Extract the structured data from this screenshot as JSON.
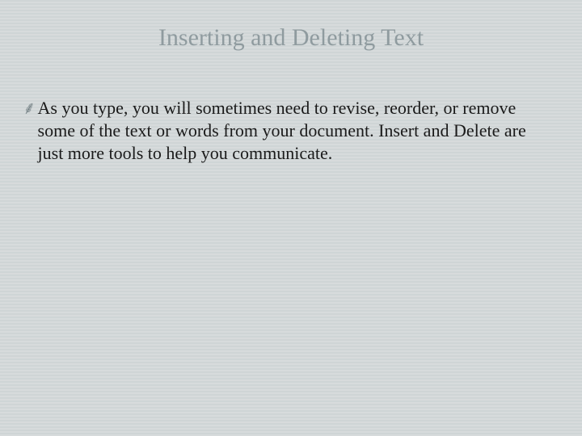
{
  "slide": {
    "title": "Inserting and Deleting Text",
    "bullets": [
      {
        "icon": "་",
        "text": "As you type, you will sometimes need to revise, reorder, or remove some of the text or words from your document. Insert and Delete are just more tools to help you communicate."
      }
    ]
  }
}
